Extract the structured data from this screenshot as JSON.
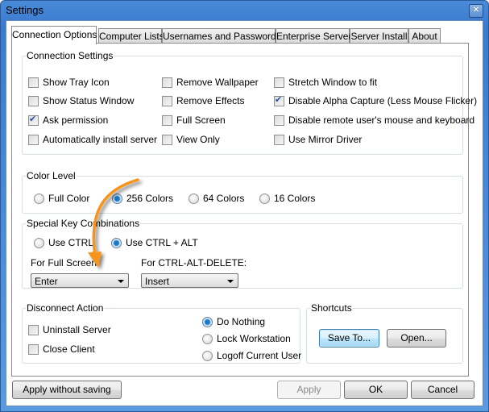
{
  "window": {
    "title": "Settings",
    "close_icon": "close-icon"
  },
  "tabs": [
    {
      "label": "Connection Options",
      "active": true
    },
    {
      "label": "Computer Lists",
      "active": false
    },
    {
      "label": "Usernames and Passwords",
      "active": false
    },
    {
      "label": "Enterprise Server",
      "active": false
    },
    {
      "label": "Server Install",
      "active": false
    },
    {
      "label": "About",
      "active": false
    }
  ],
  "connection_settings": {
    "legend": "Connection Settings",
    "options": [
      {
        "label": "Show Tray Icon",
        "checked": false
      },
      {
        "label": "Show Status Window",
        "checked": false
      },
      {
        "label": "Ask permission",
        "checked": true
      },
      {
        "label": "Automatically install server",
        "checked": false
      },
      {
        "label": "Remove Wallpaper",
        "checked": false
      },
      {
        "label": "Remove Effects",
        "checked": false
      },
      {
        "label": "Full Screen",
        "checked": false
      },
      {
        "label": "View Only",
        "checked": false
      },
      {
        "label": "Stretch Window to fit",
        "checked": false
      },
      {
        "label": "Disable Alpha Capture (Less Mouse Flicker)",
        "checked": true
      },
      {
        "label": "Disable remote user's mouse and keyboard",
        "checked": false
      },
      {
        "label": "Use Mirror Driver",
        "checked": false
      }
    ]
  },
  "color_level": {
    "legend": "Color Level",
    "options": [
      "Full Color",
      "256 Colors",
      "64 Colors",
      "16 Colors"
    ],
    "selected": "256 Colors"
  },
  "special_keys": {
    "legend": "Special Key Combinations",
    "options": [
      "Use CTRL",
      "Use CTRL + ALT"
    ],
    "selected": "Use CTRL + ALT",
    "full_screen_label": "For Full Screen:",
    "full_screen_value": "Enter",
    "cad_label": "For CTRL-ALT-DELETE:",
    "cad_value": "Insert"
  },
  "disconnect_action": {
    "legend": "Disconnect Action",
    "checkboxes": [
      {
        "label": "Uninstall Server",
        "checked": false
      },
      {
        "label": "Close Client",
        "checked": false
      }
    ],
    "radios": [
      "Do Nothing",
      "Lock Workstation",
      "Logoff Current User"
    ],
    "selected": "Do Nothing"
  },
  "shortcuts": {
    "legend": "Shortcuts",
    "save_to": "Save To...",
    "open": "Open..."
  },
  "footer": {
    "apply_without_saving": "Apply without saving",
    "apply": "Apply",
    "apply_enabled": false,
    "ok": "OK",
    "cancel": "Cancel"
  },
  "annotation": {
    "arrow_color": "#f7941d"
  }
}
